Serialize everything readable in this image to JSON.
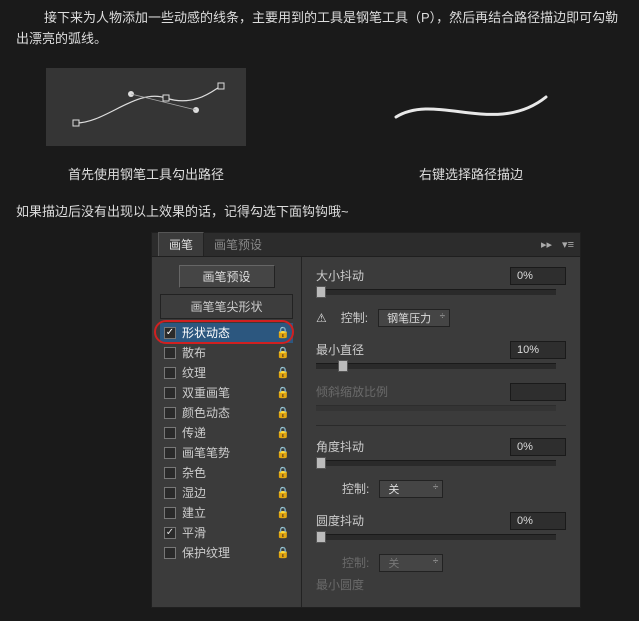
{
  "intro": "接下来为人物添加一些动感的线条，主要用到的工具是钢笔工具（P），然后再结合路径描边即可勾勒出漂亮的弧线。",
  "examples": {
    "left_caption": "首先使用钢笔工具勾出路径",
    "right_caption": "右键选择路径描边"
  },
  "note": "如果描边后没有出现以上效果的话，记得勾选下面钩钩哦~",
  "panel": {
    "tabs": {
      "active": "画笔",
      "inactive": "画笔预设"
    },
    "preset_button": "画笔预设",
    "tip_shape": "画笔笔尖形状",
    "options": [
      {
        "label": "形状动态",
        "checked": true,
        "lock": true,
        "active": true
      },
      {
        "label": "散布",
        "checked": false,
        "lock": true
      },
      {
        "label": "纹理",
        "checked": false,
        "lock": true
      },
      {
        "label": "双重画笔",
        "checked": false,
        "lock": true
      },
      {
        "label": "颜色动态",
        "checked": false,
        "lock": true
      },
      {
        "label": "传递",
        "checked": false,
        "lock": true
      },
      {
        "label": "画笔笔势",
        "checked": false,
        "lock": true
      },
      {
        "label": "杂色",
        "checked": false,
        "lock": true
      },
      {
        "label": "湿边",
        "checked": false,
        "lock": true
      },
      {
        "label": "建立",
        "checked": false,
        "lock": true
      },
      {
        "label": "平滑",
        "checked": true,
        "lock": true
      },
      {
        "label": "保护纹理",
        "checked": false,
        "lock": true
      }
    ],
    "controls": {
      "size_jitter": {
        "label": "大小抖动",
        "value": "0%"
      },
      "control1": {
        "label": "控制:",
        "value": "钢笔压力",
        "warn": "⚠"
      },
      "min_diameter": {
        "label": "最小直径",
        "value": "10%"
      },
      "tilt_scale": {
        "label": "倾斜缩放比例"
      },
      "angle_jitter": {
        "label": "角度抖动",
        "value": "0%"
      },
      "control2": {
        "label": "控制:",
        "value": "关"
      },
      "round_jitter": {
        "label": "圆度抖动",
        "value": "0%"
      },
      "control3": {
        "label": "控制:",
        "value": "关"
      },
      "min_round": {
        "label": "最小圆度"
      }
    }
  }
}
